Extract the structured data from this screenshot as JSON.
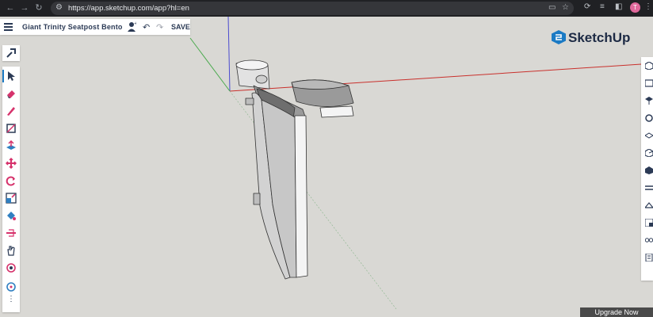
{
  "browser": {
    "url": "https://app.sketchup.com/app?hl=en",
    "profile_initial": "T"
  },
  "header": {
    "doc_title": "Giant Trinity Seatpost Bento",
    "save_label": "SAVE"
  },
  "logo": {
    "text": "SketchUp"
  },
  "left_toolbar": {
    "tools": [
      "select-icon",
      "eraser-icon",
      "pencil-icon",
      "rectangle-icon",
      "push-pull-icon",
      "move-icon",
      "rotate-icon",
      "scale-icon",
      "paint-bucket-icon",
      "section-plane-icon",
      "pan-icon",
      "orbit-icon",
      "tape-measure-icon"
    ],
    "more_label": "⋮"
  },
  "right_toolbar": {
    "tools": [
      "entity-info-icon",
      "instructor-icon",
      "components-icon",
      "materials-icon",
      "styles-icon",
      "scenes-icon",
      "layers-icon",
      "outliner-icon",
      "solid-tools-icon",
      "display-icon",
      "glasses-icon",
      "report-icon"
    ]
  },
  "upgrade": {
    "label": "Upgrade Now"
  },
  "colors": {
    "viewport_bg": "#d9d8d4",
    "axis_red": "#c9302c",
    "axis_green": "#4caa4f",
    "axis_blue": "#4a4ad0",
    "ui_navy": "#2b3a55",
    "accent_blue": "#1b7ac4"
  }
}
